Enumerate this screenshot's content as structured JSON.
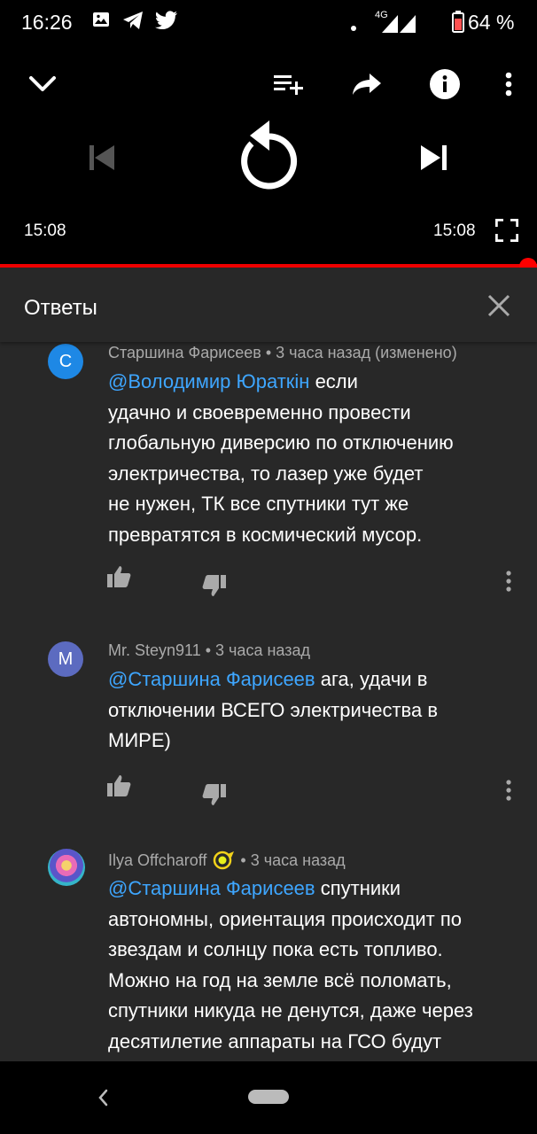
{
  "status_bar": {
    "time": "16:26",
    "network": "4G",
    "battery": "64 %"
  },
  "player": {
    "elapsed": "15:08",
    "duration": "15:08",
    "progress": 1.0
  },
  "replies_panel": {
    "title": "Ответы",
    "comments": [
      {
        "avatar_letter": "С",
        "avatar_color": "#1e88e5",
        "author": "Старшина Фарисеев",
        "time": "3 часа назад (изменено)",
        "mention": "@Володимир Юраткін",
        "lines": [
          "если",
          "удачно и своевременно провести",
          "глобальную диверсию по отключению",
          "электричества, то лазер уже будет",
          "не нужен, ТК все спутники тут же",
          "превратятся в космический мусор."
        ]
      },
      {
        "avatar_letter": "M",
        "avatar_color": "#5c6bc0",
        "author": "Mr. Steyn911",
        "time": "3 часа назад",
        "mention": "@Старшина Фарисеев",
        "lines": [
          "ага, удачи в",
          "отключении ВСЕГО электричества в",
          "МИРЕ)"
        ]
      },
      {
        "avatar_letter": "",
        "avatar_color": "#7e57c2",
        "author": "Ilya Offcharoff",
        "time": "3 часа назад",
        "mention": "@Старшина Фарисеев",
        "lines": [
          "спутники",
          "автономны, ориентация происходит по",
          "звездам и солнцу пока есть топливо.",
          "Можно на год на земле всё поломать,",
          "спутники никуда не денутся, даже через",
          "десятилетие аппараты на ГСО будут"
        ]
      }
    ]
  },
  "colors": {
    "accent_red": "#ff0000",
    "link_blue": "#3ea6ff",
    "panel_bg": "#282828"
  }
}
